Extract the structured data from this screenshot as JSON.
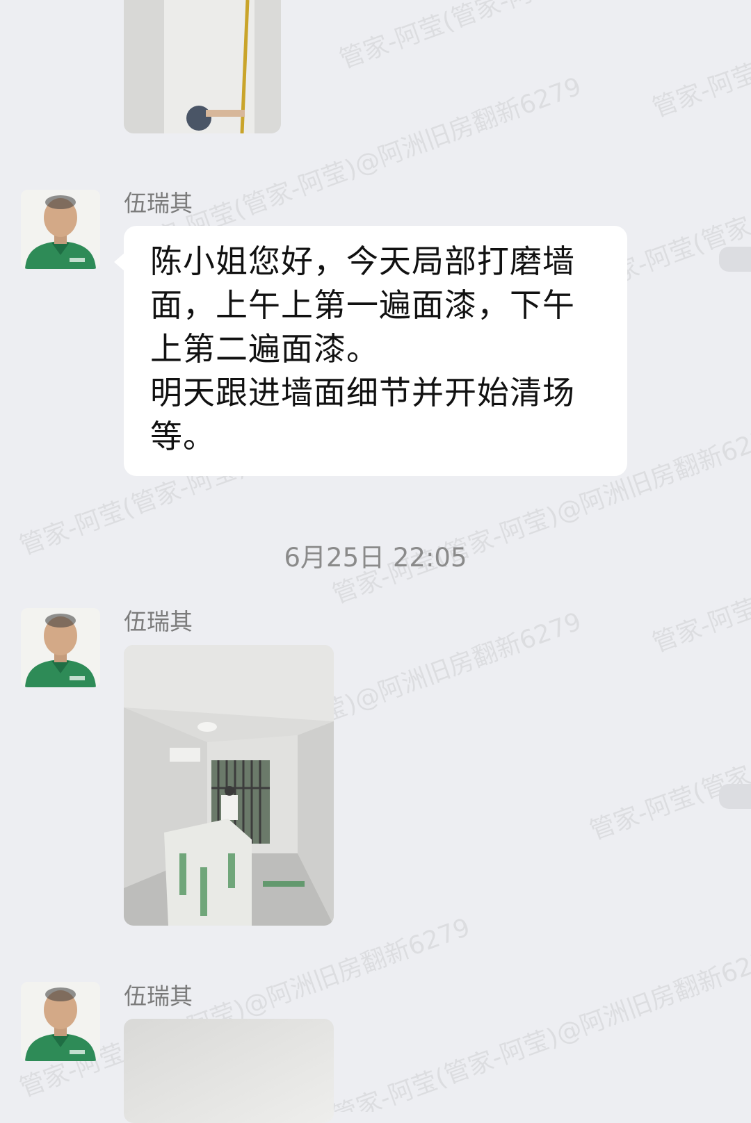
{
  "chat": {
    "watermark_text": "管家-阿莹(管家-阿莹)@阿洲旧房翻新6279",
    "messages": [
      {
        "type": "image",
        "description": "photo-wall-painting-roller"
      },
      {
        "type": "text",
        "sender": "伍瑞其",
        "text": "陈小姐您好，今天局部打磨墙\n面，上午上第一遍面漆，下午\n上第二遍面漆。\n明天跟进墙面细节并开始清场\n等。"
      },
      {
        "type": "timestamp",
        "text": "6月25日  22:05"
      },
      {
        "type": "image",
        "sender": "伍瑞其",
        "description": "photo-room-painting"
      },
      {
        "type": "image",
        "sender": "伍瑞其",
        "description": "photo-blank-wall"
      }
    ]
  },
  "colors": {
    "background": "#EDEEF2",
    "bubble": "#FFFFFF",
    "sender_text": "#7b7b7b",
    "timestamp_text": "#8a8a8a",
    "uniform_green": "#2E8B57"
  }
}
